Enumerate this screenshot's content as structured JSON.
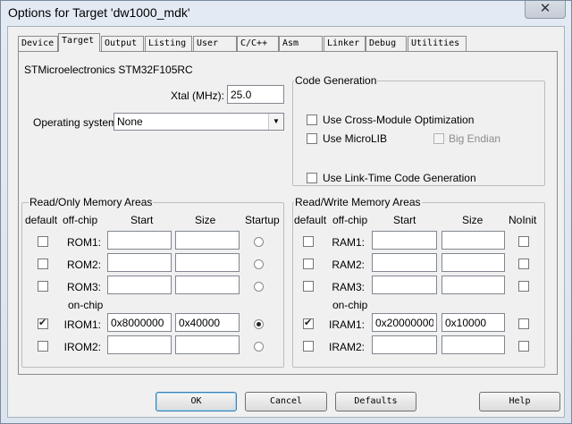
{
  "window": {
    "title": "Options for Target 'dw1000_mdk'",
    "close_glyph": "✕",
    "close_icon": "close-icon"
  },
  "tabs": [
    {
      "label": "Device"
    },
    {
      "label": "Target"
    },
    {
      "label": "Output"
    },
    {
      "label": "Listing"
    },
    {
      "label": "User"
    },
    {
      "label": "C/C++"
    },
    {
      "label": "Asm"
    },
    {
      "label": "Linker"
    },
    {
      "label": "Debug"
    },
    {
      "label": "Utilities"
    }
  ],
  "active_tab": "Target",
  "device_name": "STMicroelectronics STM32F105RC",
  "xtal": {
    "label": "Xtal (MHz):",
    "value": "25.0"
  },
  "os": {
    "label": "Operating system:",
    "selected": "None",
    "arrow_glyph": "▼"
  },
  "code_generation": {
    "title": "Code Generation",
    "cross_module": {
      "label": "Use Cross-Module Optimization",
      "checked": false
    },
    "microlib": {
      "label": "Use MicroLIB",
      "checked": false
    },
    "big_endian": {
      "label": "Big Endian",
      "checked": false,
      "enabled": false
    },
    "link_time": {
      "label": "Use Link-Time Code Generation",
      "checked": false
    }
  },
  "ro_memory": {
    "title": "Read/Only Memory Areas",
    "headers": {
      "default": "default",
      "offchip": "off-chip",
      "start": "Start",
      "size": "Size",
      "startup": "Startup"
    },
    "onchip_label": "on-chip",
    "rows": [
      {
        "name": "ROM1:",
        "start": "",
        "size": "",
        "default": false,
        "startup": false
      },
      {
        "name": "ROM2:",
        "start": "",
        "size": "",
        "default": false,
        "startup": false
      },
      {
        "name": "ROM3:",
        "start": "",
        "size": "",
        "default": false,
        "startup": false
      },
      {
        "name": "IROM1:",
        "start": "0x8000000",
        "size": "0x40000",
        "default": true,
        "startup": true
      },
      {
        "name": "IROM2:",
        "start": "",
        "size": "",
        "default": false,
        "startup": false
      }
    ]
  },
  "rw_memory": {
    "title": "Read/Write Memory Areas",
    "headers": {
      "default": "default",
      "offchip": "off-chip",
      "start": "Start",
      "size": "Size",
      "noinit": "NoInit"
    },
    "onchip_label": "on-chip",
    "rows": [
      {
        "name": "RAM1:",
        "start": "",
        "size": "",
        "default": false,
        "noinit": false
      },
      {
        "name": "RAM2:",
        "start": "",
        "size": "",
        "default": false,
        "noinit": false
      },
      {
        "name": "RAM3:",
        "start": "",
        "size": "",
        "default": false,
        "noinit": false
      },
      {
        "name": "IRAM1:",
        "start": "0x20000000",
        "size": "0x10000",
        "default": true,
        "noinit": false
      },
      {
        "name": "IRAM2:",
        "start": "",
        "size": "",
        "default": false,
        "noinit": false
      }
    ]
  },
  "buttons": {
    "ok": "OK",
    "cancel": "Cancel",
    "defaults": "Defaults",
    "help": "Help"
  }
}
